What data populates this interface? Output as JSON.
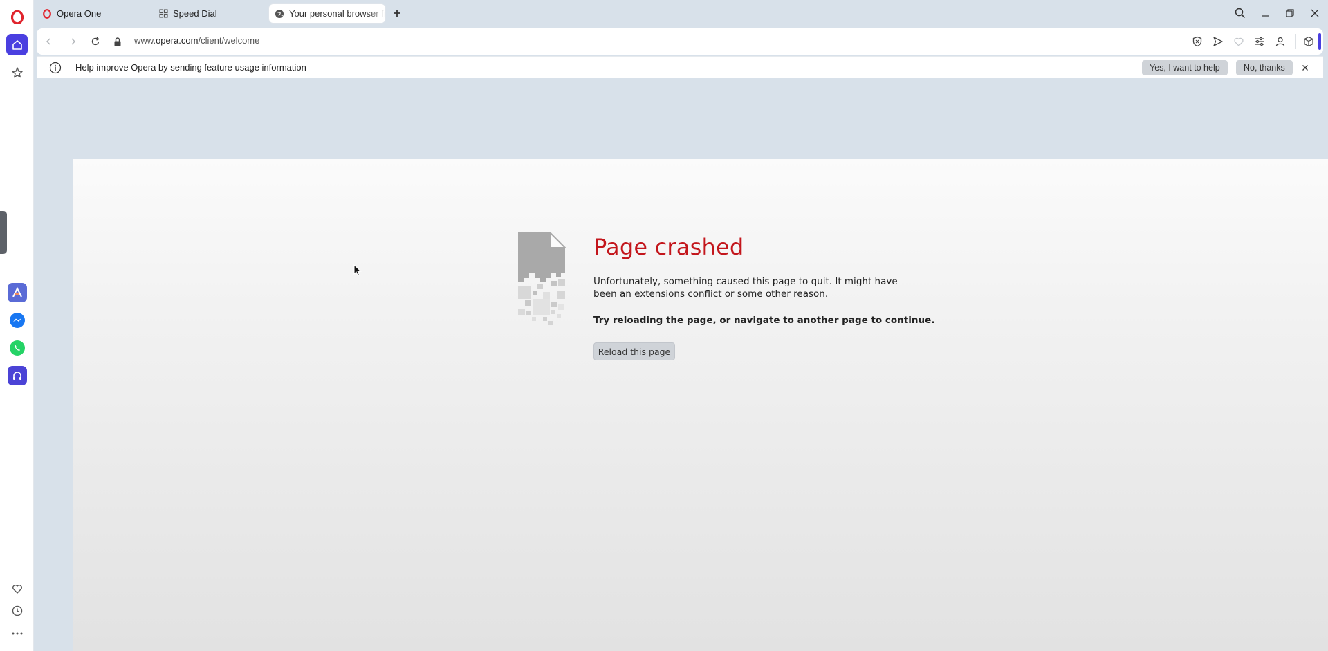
{
  "tabs": [
    {
      "label": "Opera One",
      "icon": "opera-logo-icon"
    },
    {
      "label": "Speed Dial",
      "icon": "grid-icon"
    },
    {
      "label": "Your personal browser fr",
      "icon": "globe-icon"
    }
  ],
  "address": {
    "url_prefix": "www.",
    "url_host": "opera.com",
    "url_path": "/client/welcome"
  },
  "infobar": {
    "message": "Help improve Opera by sending feature usage information",
    "accept_label": "Yes, I want to help",
    "decline_label": "No, thanks"
  },
  "crash": {
    "title": "Page crashed",
    "description": "Unfortunately, something caused this page to quit. It might have been an extensions conflict or some other reason.",
    "hint": "Try reloading the page, or navigate to another page to continue.",
    "reload_label": "Reload this page"
  },
  "colors": {
    "accent": "#4a3fe0",
    "opera_red": "#e0242d",
    "crash_title": "#c3161c"
  }
}
